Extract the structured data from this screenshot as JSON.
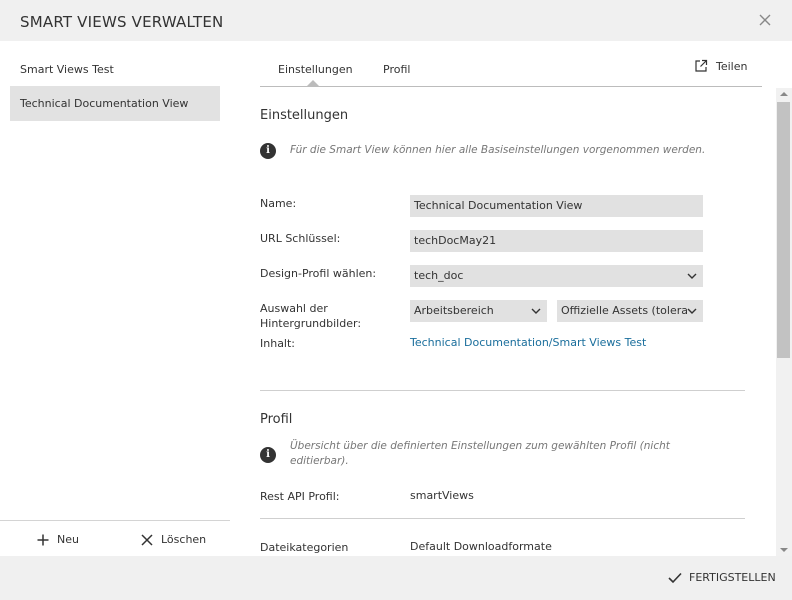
{
  "dialog": {
    "title": "SMART VIEWS VERWALTEN",
    "close_icon": "close-icon"
  },
  "sidebar": {
    "items": [
      {
        "label": "Smart Views Test",
        "active": false
      },
      {
        "label": "Technical Documentation View",
        "active": true
      }
    ],
    "new_label": "Neu",
    "delete_label": "Löschen"
  },
  "tabs": {
    "items": [
      {
        "label": "Einstellungen",
        "active": true
      },
      {
        "label": "Profil",
        "active": false
      }
    ],
    "share_label": "Teilen"
  },
  "settings": {
    "title": "Einstellungen",
    "info": "Für die Smart View können hier alle Basiseinstellungen vorgenommen werden.",
    "name_label": "Name:",
    "name_value": "Technical Documentation View",
    "url_key_label": "URL Schlüssel:",
    "url_key_value": "techDocMay21",
    "design_label": "Design-Profil wählen:",
    "design_value": "tech_doc",
    "background_label": "Auswahl der Hintergrundbilder:",
    "background_value_1": "Arbeitsbereich",
    "background_value_2": "Offizielle Assets (tolera",
    "content_label": "Inhalt:",
    "content_link": "Technical Documentation/Smart Views Test"
  },
  "profile": {
    "title": "Profil",
    "info": "Übersicht über die definierten Einstellungen zum gewählten Profil (nicht editierbar).",
    "rest_api_label": "Rest API Profil:",
    "rest_api_value": "smartViews",
    "file_categories_label": "Dateikategorien",
    "file_categories_value": "Default Downloadformate"
  },
  "footer": {
    "finish_label": "FERTIGSTELLEN"
  }
}
